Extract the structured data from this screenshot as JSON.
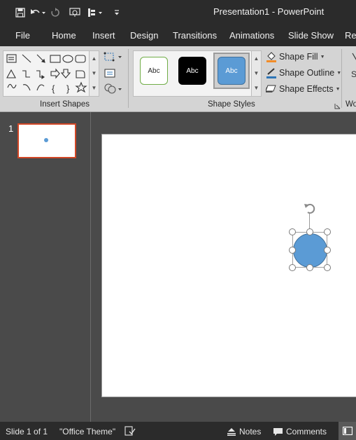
{
  "title": "Presentation1 - PowerPoint",
  "qat": {
    "save_icon": "save-icon",
    "undo_icon": "undo-icon",
    "redo_icon": "redo-icon",
    "present_icon": "start-from-beginning-icon",
    "touch_icon": "touch-mouse-mode-icon",
    "customize_icon": "customize-qat-icon"
  },
  "tabs": [
    "File",
    "Home",
    "Insert",
    "Design",
    "Transitions",
    "Animations",
    "Slide Show",
    "Rev"
  ],
  "ribbon": {
    "insert_shapes": {
      "label": "Insert Shapes"
    },
    "shape_styles": {
      "label": "Shape Styles",
      "thumbs": [
        {
          "text": "Abc",
          "fill": "#ffffff",
          "border": "#70ad47",
          "color": "#262626"
        },
        {
          "text": "Abc",
          "fill": "#000000",
          "border": "#000000",
          "color": "#ffffff"
        },
        {
          "text": "Abc",
          "fill": "#5b9bd5",
          "border": "#41719c",
          "color": "#ffffff"
        }
      ],
      "shape_fill": "Shape Fill",
      "shape_outline": "Shape Outline",
      "shape_effects": "Shape Effects"
    },
    "next_group_label": "Wo"
  },
  "thumbnails": {
    "slide_number": "1"
  },
  "colors": {
    "accent": "#d24726",
    "shape_fill": "#5b9bd5",
    "shape_outline": "#41719c"
  },
  "statusbar": {
    "slide_info": "Slide 1 of 1",
    "theme": "\"Office Theme\"",
    "notes": "Notes",
    "comments": "Comments"
  }
}
